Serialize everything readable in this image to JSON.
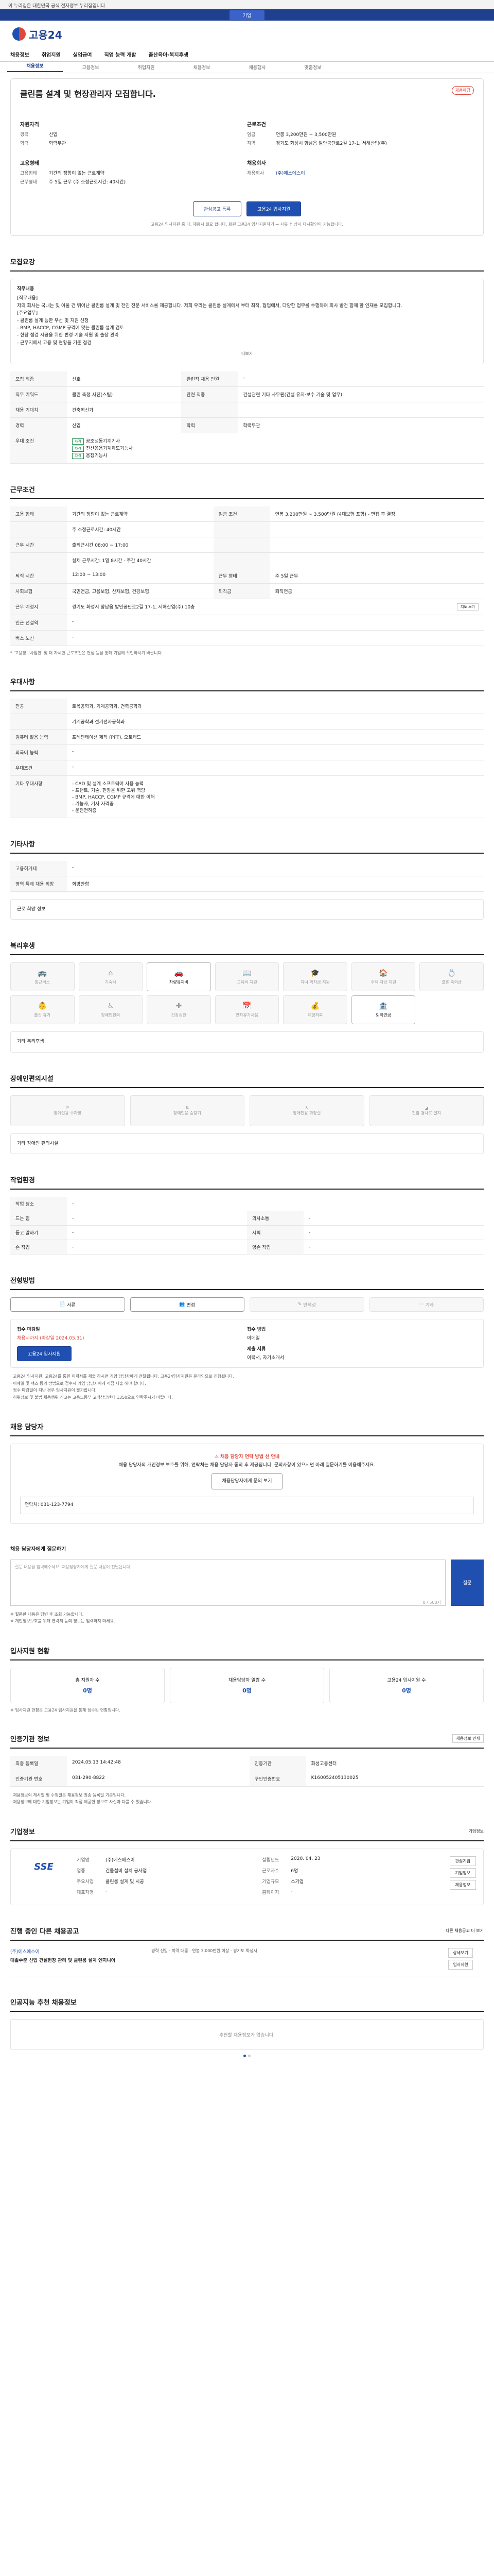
{
  "topbar": {
    "notice": "이 누리집은 대한민국 공식 전자정부 누리집입니다."
  },
  "subbar": {
    "label": "기업"
  },
  "logo": {
    "text": "고용24"
  },
  "gnb": [
    "채용정보",
    "취업지원",
    "실업급여",
    "직업 능력 개발",
    "출산육아·복지후생"
  ],
  "lnb": [
    {
      "label": "채용정보",
      "on": true
    },
    {
      "label": "고용정보",
      "on": false
    },
    {
      "label": "취업지원",
      "on": false
    },
    {
      "label": "채용정보",
      "on": false
    },
    {
      "label": "채용행사",
      "on": false
    },
    {
      "label": "맞춤정보",
      "on": false
    }
  ],
  "hero": {
    "title": "클린룸 설계 및 현장관리자 모집합니다.",
    "badge": "채용마감",
    "left_title": "자원자격",
    "left": [
      {
        "k": "경력",
        "v": "신입"
      },
      {
        "k": "학력",
        "v": "학력무관"
      }
    ],
    "right_title": "근로조건",
    "right": [
      {
        "k": "임금",
        "v": "연봉 3,200만원 ~ 3,500만원"
      },
      {
        "k": "지역",
        "v": "경기도 화성시 향남읍 발안공단로2길 17-1, 서해산업(주)"
      }
    ],
    "left2_title": "고용형태",
    "left2": [
      {
        "k": "고용형태",
        "v": "기간의 정함이 없는 근로계약"
      },
      {
        "k": "근무형태",
        "v": "주 5일 근무 (주 소정근로시간: 40시간)"
      }
    ],
    "right2_title": "채용회사",
    "right2": [
      {
        "k": "채용회사",
        "v": "(주)에스에스이"
      }
    ],
    "btn1": "관심공고 등록",
    "btn2": "고용24 입사지원",
    "note": "고용24 입사지원 중 다, 채용시 필요 합니다. 회원 고용24 입사지원하기 → 사유 ↑ 상시 다시확인이 가능합니다."
  },
  "recruit": {
    "title": "모집요강",
    "box_title": "직무내용",
    "box_lines": [
      "[직무내용]",
      "저의 회사는 국내는 및 아울 건 뛰어난 클린룸 설계 및 전인 전문 서비스를 제공합니다. 저희 우리는 클린룸 설계에서 부터 최적, 협업에서, 다양한 업무를 수행하여 회사 발전 함께 할 인재를 모집합니다.",
      "[주요업무]",
      "- 클린룸 설계 능한 우선 및 지원 신청",
      "- BMP, HACCP, CGMP 규격에 맞는 클린룸 설계 검토",
      "- 현장 점검 시공을 위한 변경 기술 지원 및 출장 관리",
      "- 근무지에서 고용 및 현황을 기준 점검"
    ],
    "more": "더보기",
    "rows": [
      {
        "k": "모집 직종",
        "v": "신호",
        "k2": "관련직 채용 인원",
        "v2": "-"
      },
      {
        "k": "직무 키워드",
        "v": "클린 측정 사진(스틸)",
        "k2": "관련 직종",
        "v2": "건설관련 기타 사무원(건설 유지·보수 기술 및 업무)"
      },
      {
        "k": "채용 기대치",
        "v": "건축혁신가",
        "k2": "",
        "v2": ""
      },
      {
        "k": "경력",
        "v": "신입",
        "k2": "학력",
        "v2": "학력무관"
      }
    ],
    "certs_label": "우대 조건",
    "certs": [
      "공조냉동기계기사",
      "전산응용기계제도기능사",
      "용접기능사"
    ],
    "cert_tag": "자격"
  },
  "work": {
    "title": "근무조건",
    "rows": [
      {
        "k": "고용 형태",
        "v": "기간의 정함이 없는 근로계약",
        "k2": "임금 조건",
        "v2": "연봉 3,200만원 ~ 3,500만원 (4대보험 포함) - 면접 후 결정"
      },
      {
        "k": "",
        "v": "주 소정근로시간: 40시간",
        "k2": "",
        "v2": ""
      },
      {
        "k": "근무 시간",
        "v": "출퇴근시간 08:00 ~ 17:00",
        "k2": "",
        "v2": ""
      },
      {
        "k": "",
        "v": "실제 근무시간: 1일 8시간 · 주간 40시간",
        "k2": "",
        "v2": ""
      },
      {
        "k": "퇴직 시간",
        "v": "12:00 ~ 13:00",
        "k2": "근무 형태",
        "v2": "주 5일 근무"
      },
      {
        "k": "사회보험",
        "v": "국민연금, 고용보험, 산재보험, 건강보험",
        "k2": "퇴직금",
        "v2": "퇴직연금"
      },
      {
        "k": "근무 예정지",
        "v": "경기도 화성시 향남읍 발안공단로2길 17-1, 서해산업(주) 10층",
        "k2": "",
        "v2": ""
      },
      {
        "k": "인근 전철역",
        "v": "-",
        "k2": "",
        "v2": ""
      },
      {
        "k": "버스 노선",
        "v": "-",
        "k2": "",
        "v2": ""
      }
    ],
    "map_btn": "지도 보기",
    "foot": "* '고용정보사업안' 및 더 자세한 근로조건은 면접 등을 통해 기업에 확인하시기 바랍니다."
  },
  "prefer": {
    "title": "우대사항",
    "rows": [
      {
        "k": "전공",
        "v": "토목공학과, 기계공학과, 건축공학과"
      },
      {
        "k": "",
        "v": "기계공학과 전기전자공학과"
      },
      {
        "k": "컴퓨터 활용 능력",
        "v": "프레젠테이션 제작 (PPT), 오토캐드"
      },
      {
        "k": "외국어 능력",
        "v": "-"
      },
      {
        "k": "우대조건",
        "v": "-"
      },
      {
        "k": "기타 우대사항",
        "v": "- CAD 및 설계 소프트웨어 사용 능력"
      },
      {
        "k": "",
        "v": "- 프랜트, 기술, 현장을 위한 고위 역량"
      },
      {
        "k": "",
        "v": "- BMP, HACCP, CGMP 규격에 대한 이해"
      },
      {
        "k": "",
        "v": "- 기능사, 기사 자격증"
      },
      {
        "k": "",
        "v": "- 운전면허증"
      }
    ]
  },
  "etc": {
    "title": "기타사항",
    "rows": [
      {
        "k": "고용허가제",
        "v": "-"
      },
      {
        "k": "병역 특례 채용 희망",
        "v": "희망안함"
      }
    ],
    "note": "근로 희망 정보"
  },
  "welfare": {
    "title": "복리후생",
    "items": [
      {
        "label": "통근버스",
        "on": false
      },
      {
        "label": "기숙사",
        "on": false
      },
      {
        "label": "차량유지비",
        "on": true
      },
      {
        "label": "교육비 지원",
        "on": false
      },
      {
        "label": "자녀 학자금 지원",
        "on": false
      },
      {
        "label": "주택 자금 지원",
        "on": false
      },
      {
        "label": "결혼 축의금",
        "on": false
      },
      {
        "label": "출산 휴가",
        "on": false
      },
      {
        "label": "장애인편의",
        "on": false
      },
      {
        "label": "건강검진",
        "on": false
      },
      {
        "label": "연차휴가사용",
        "on": false
      },
      {
        "label": "재형저축",
        "on": false
      },
      {
        "label": "퇴직연금",
        "on": true
      }
    ],
    "note": "기타 복리후생"
  },
  "disability": {
    "title": "장애인편의시설",
    "items": [
      "장애인용 주차장",
      "장애인용 승강기",
      "장애인용 화장실",
      "진입 경사로 설치"
    ],
    "note": "기타 장애인 편의시설"
  },
  "work_env": {
    "title": "작업환경",
    "rows": [
      {
        "k": "작업 청소",
        "v": "-",
        "k2": "",
        "v2": ""
      },
      {
        "k": "드는 힘",
        "v": "-",
        "k2": "의사소통",
        "v2": "-"
      },
      {
        "k": "듣고 말하기",
        "v": "-",
        "k2": "시력",
        "v2": "-"
      },
      {
        "k": "손 작업",
        "v": "-",
        "k2": "양손 작업",
        "v2": "-"
      }
    ]
  },
  "selection": {
    "title": "전형방법",
    "methods": [
      {
        "label": "서류",
        "on": true
      },
      {
        "label": "면접",
        "on": true
      },
      {
        "label": "인적성",
        "on": false
      },
      {
        "label": "기타",
        "on": false
      }
    ],
    "apply_label": "접수 마감일",
    "apply_deadline": "채용시까지 (마감일 2024.05.31)",
    "apply_btn": "고용24 입사지원",
    "doc_label": "접수 방법",
    "doc_value": "이메일",
    "doc2_label": "제출 서류",
    "doc2_value": "이력서, 자기소개서",
    "bullets": [
      "고용24 입사지원: 고용24를 통한 이력서를 제출 하시면 기업 담당자에게 전달됩니다. 고용24입사지원은 온라인으로 진행됩니다.",
      "이메일 및 팩스 등의 방법으로 접수시 기업 담당자에게 직접 제출 해야 합니다.",
      "접수 마감일이 지난 경우 입사지원이 불가합니다.",
      "허위정보 및 불법 채용행위 신고는 고용노동부 고객상담센터 1350으로 연락주시기 바랍니다."
    ]
  },
  "manager": {
    "title": "채용 담당자",
    "alert_title": "채용 담당자 연락 방법 선 안내",
    "alert_body": "채용 담당자의 개인정보 보호를 위해, 연락처는 채용 담당자 동의 후 제공됩니다. 문의사항이 있으시면 아래 질문하기를 이용해주세요.",
    "alert_btn": "채용담당자에게 문의 보기",
    "contact": "연락처: 031-123-7794"
  },
  "qa": {
    "title": "채용 담당자에게 질문하기",
    "placeholder": "질문 내용을 입력해주세요. 채용담당자에게 질문 내용이 전달됩니다.",
    "count": "0 / 500자",
    "btn": "질문",
    "notes": [
      "※ 질문한 내용은 답변 후 조회 가능합니다.",
      "※ 개인정보보호를 위해 연락처 등의 정보는 입력하지 마세요."
    ]
  },
  "stats": {
    "title": "입사지원 현황",
    "items": [
      {
        "label": "총 지원자 수",
        "value": "0명"
      },
      {
        "label": "채용담당자 열람 수",
        "value": "0명"
      },
      {
        "label": "고용24 입사지원 수",
        "value": "0명"
      }
    ],
    "note": "※ 입사지원 현황은 고용24 입사지원을 통해 접수된 현황입니다."
  },
  "info": {
    "title": "인증기관 정보",
    "btn": "채용정보 인쇄",
    "rows": [
      {
        "k": "최종 등록일",
        "v": "2024.05.13 14:42:48",
        "k2": "인증기관",
        "v2": "화성고용센터"
      },
      {
        "k": "인증기관 번호",
        "v": "031-290-8822",
        "k2": "구인인증번호",
        "v2": "K160052405130025"
      }
    ],
    "notes": [
      "채용정보의 게시일 및 수정일은 채용정보 최종 등록일 기준입니다.",
      "채용정보에 대한 기업정보는 기업이 직접 제공한 정보로 사실과 다를 수 있습니다."
    ]
  },
  "company": {
    "title": "기업정보",
    "more": "기업정보",
    "logo_text": "SSE",
    "rows": [
      {
        "k": "기업명",
        "v": "(주)에스에스이"
      },
      {
        "k": "설립년도",
        "v": "2020. 04. 23"
      },
      {
        "k": "업종",
        "v": "건물설비 설치 공사업"
      },
      {
        "k": "근로자수",
        "v": "6명"
      },
      {
        "k": "주요사업",
        "v": "클린룸 설계 및 시공"
      },
      {
        "k": "기업규모",
        "v": "소기업"
      },
      {
        "k": "대표자명",
        "v": "-"
      },
      {
        "k": "홈페이지",
        "v": "-"
      }
    ],
    "btns": [
      "관심기업",
      "기업정보",
      "채용정보"
    ]
  },
  "other": {
    "title": "진행 중인 다른 채용공고",
    "right": "다른 채용공고 더 보기",
    "company": "(주)에스에스이",
    "post_title": "대졸수준 신입 건설현장 관리 및 클린룸 설계 엔지니어",
    "meta": "경력 신입 · 학력 대졸 · 연봉 3,000만원 이상 · 경기도 화성시",
    "tags": [
      "상세보기",
      "입사지원"
    ]
  },
  "recommend": {
    "title": "인공지능 추천 채용정보",
    "empty": "추천할 채용정보가 없습니다."
  }
}
